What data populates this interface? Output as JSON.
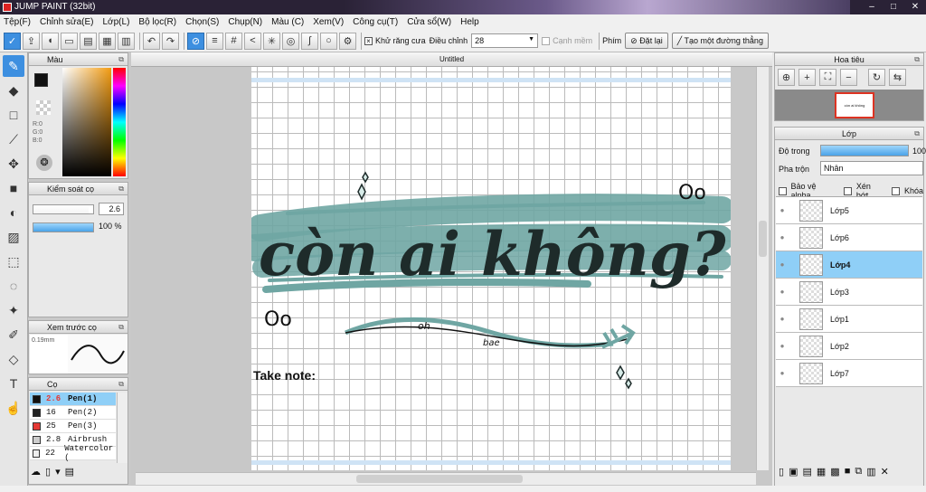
{
  "window": {
    "title": "JUMP PAINT (32bit)",
    "min": "–",
    "max": "□",
    "close": "✕"
  },
  "menu": [
    "Tệp(F)",
    "Chỉnh sửa(E)",
    "Lớp(L)",
    "Bộ lọc(R)",
    "Chọn(S)",
    "Chụp(N)",
    "Màu (C)",
    "Xem(V)",
    "Công cụ(T)",
    "Cửa sổ(W)",
    "Help"
  ],
  "toolbar": {
    "antialias_label": "Khử răng cưa",
    "antialias_checked": true,
    "adjust_label": "Điều chỉnh",
    "adjust_value": "28",
    "edge_label": "Cạnh mềm",
    "key_label": "Phím",
    "reset_label": "Đặt lại",
    "line_label": "Tạo một đường thẳng"
  },
  "color_panel": {
    "title": "Màu",
    "r": "R:0",
    "g": "G:0",
    "b": "B:0",
    "fg": "#111111",
    "bg": "#e53935"
  },
  "brush_control": {
    "title": "Kiểm soát cọ",
    "size": "2.6",
    "opacity": "100 %",
    "size_fraction": 0.92,
    "opacity_fraction": 1.0
  },
  "brush_preview": {
    "title": "Xem trước cọ",
    "size_label": "0.19mm"
  },
  "brushes": {
    "title": "Cọ",
    "items": [
      {
        "size": "2.6",
        "name": "Pen(1)",
        "color": "#111111",
        "selected": true
      },
      {
        "size": "16",
        "name": "Pen(2)",
        "color": "#222222",
        "selected": false
      },
      {
        "size": "25",
        "name": "Pen(3)",
        "color": "#e53935",
        "selected": false
      },
      {
        "size": "2.8",
        "name": "Airbrush",
        "color": "#cccccc",
        "selected": false
      },
      {
        "size": "22",
        "name": "Watercolor (",
        "color": "#eeeeee",
        "selected": false
      }
    ]
  },
  "document": {
    "tab_title": "Untitled",
    "main_text": "còn ai không?",
    "small_text_1": "oh",
    "small_text_2": "bae",
    "oo_1": "Oo",
    "oo_2": "Oo",
    "note": "Take note:"
  },
  "navigator": {
    "title": "Hoa tiêu",
    "thumb_text": "còn ai không"
  },
  "layers": {
    "title": "Lớp",
    "opacity_label": "Độ trong",
    "opacity_value": "100",
    "blend_label": "Pha trộn",
    "blend_value": "Nhân",
    "protect_alpha": "Bảo vệ alpha",
    "clip": "Xén bớt",
    "lock": "Khóa",
    "items": [
      {
        "name": "Lớp5",
        "selected": false
      },
      {
        "name": "Lớp6",
        "selected": false
      },
      {
        "name": "Lớp4",
        "selected": true
      },
      {
        "name": "Lớp3",
        "selected": false
      },
      {
        "name": "Lớp1",
        "selected": false
      },
      {
        "name": "Lớp2",
        "selected": false
      },
      {
        "name": "Lớp7",
        "selected": false
      }
    ]
  },
  "colors": {
    "accent": "#3d8fe0",
    "selected_row": "#8fcff7",
    "teal": "#6fa6a3"
  }
}
